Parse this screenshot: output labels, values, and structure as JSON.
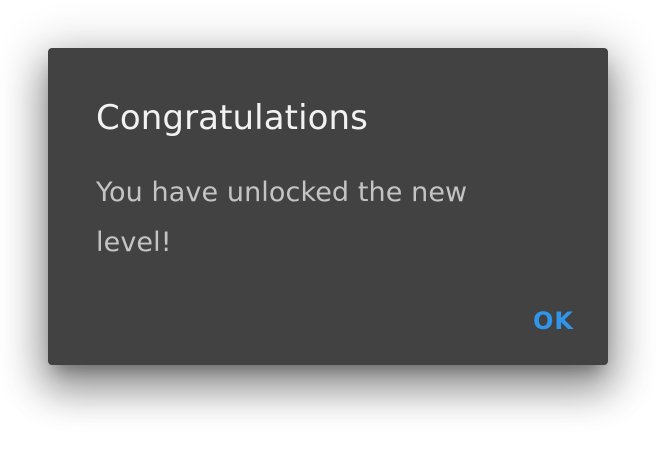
{
  "dialog": {
    "title": "Congratulations",
    "message": "You have unlocked the new level!",
    "button_ok_label": "OK"
  },
  "colors": {
    "dialog_background": "#424242",
    "title_text": "#f2f2f2",
    "body_text": "#c4c4c4",
    "accent": "#2f96ec",
    "page_background": "#ffffff"
  }
}
